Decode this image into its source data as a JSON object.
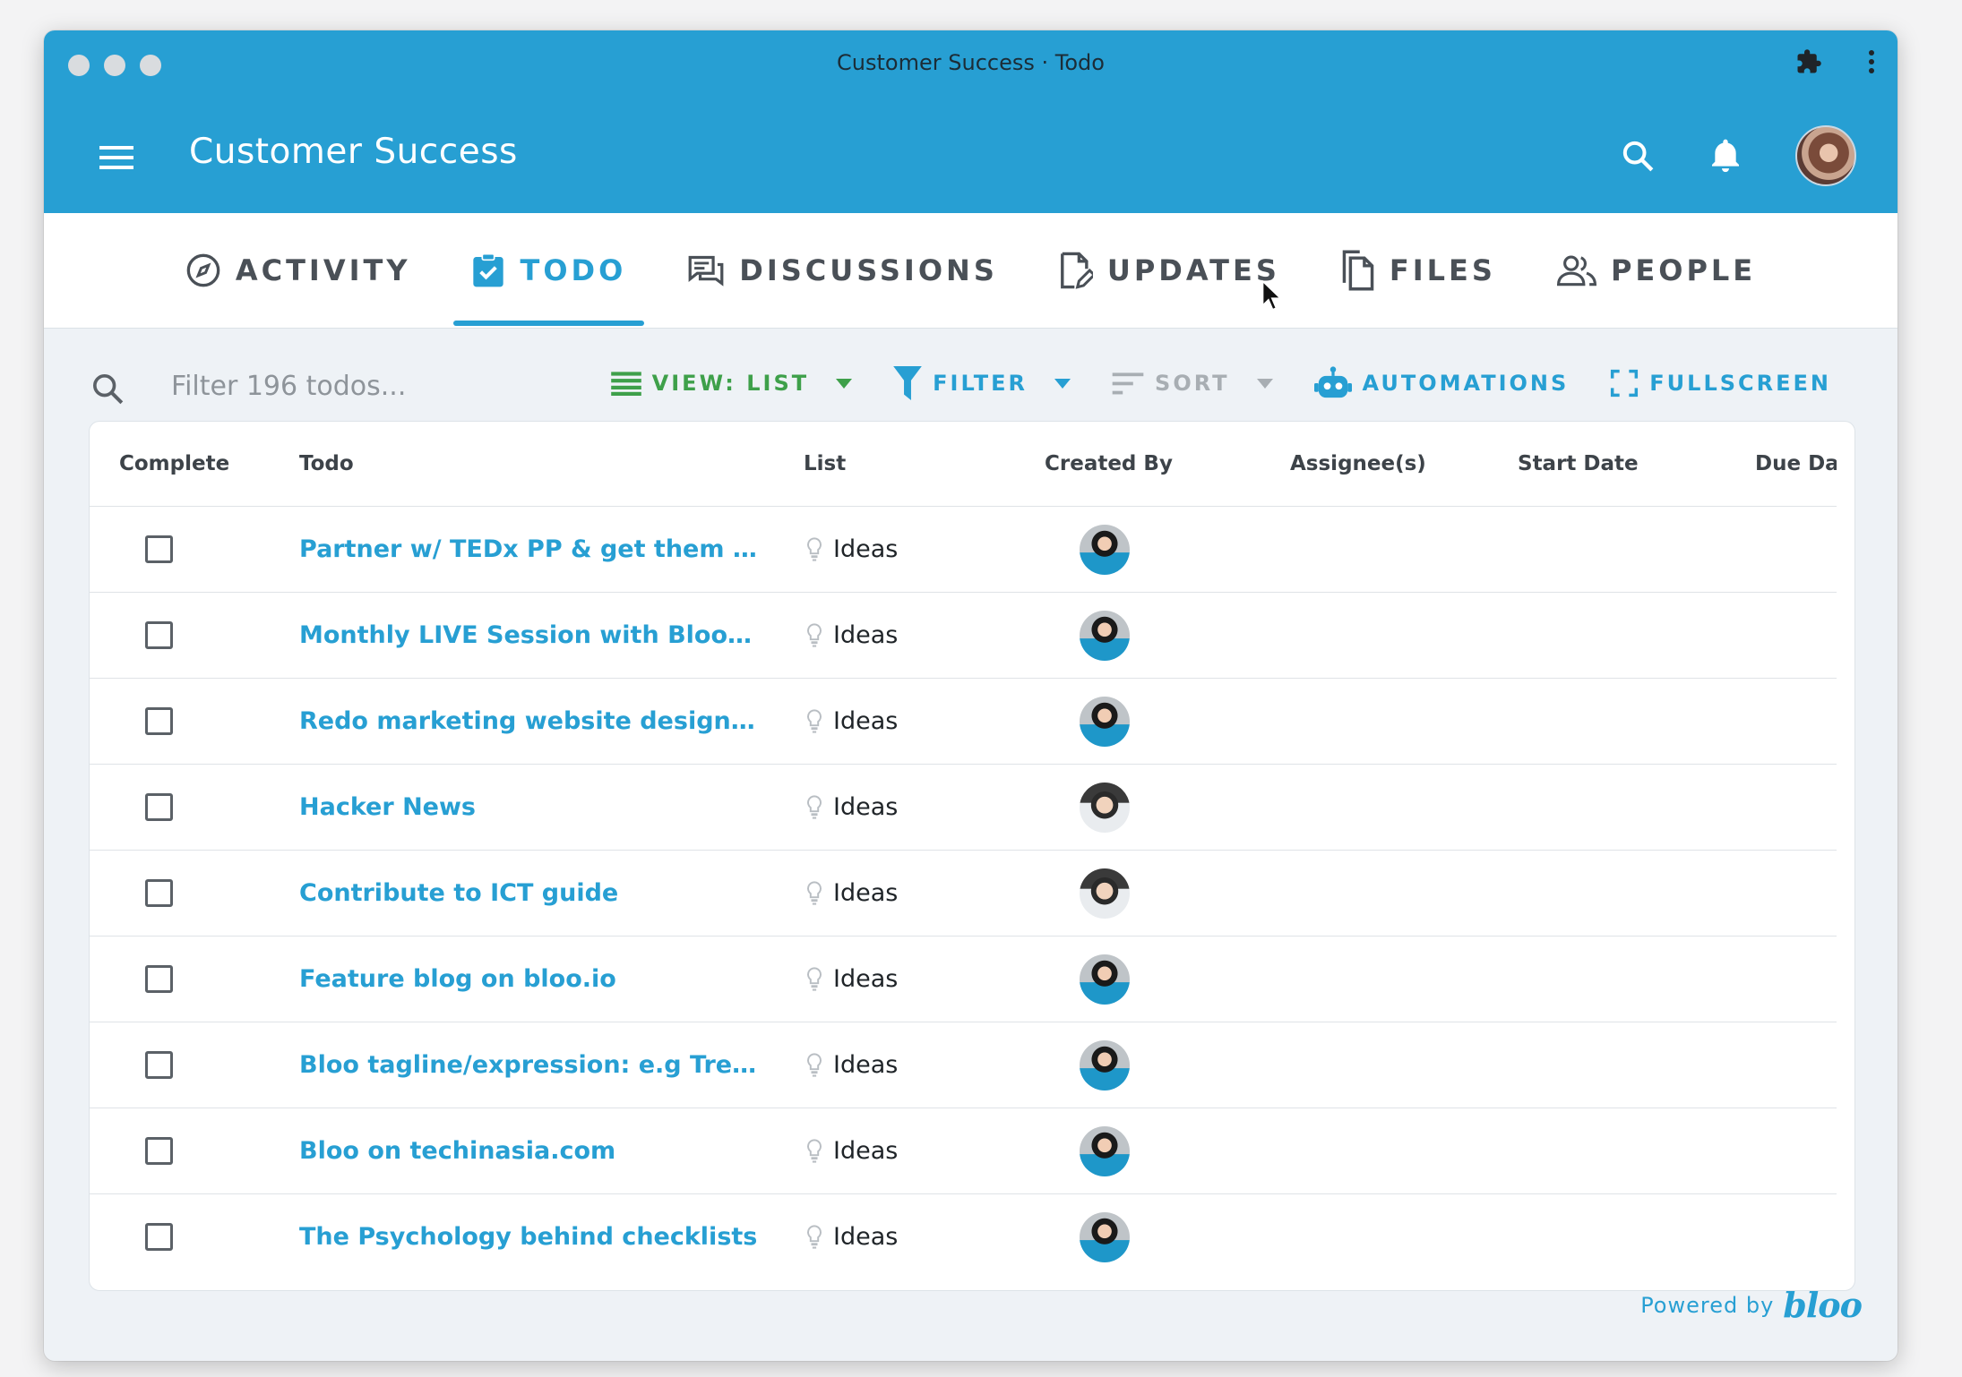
{
  "window": {
    "title": "Customer Success · Todo"
  },
  "header": {
    "app_title": "Customer Success"
  },
  "tabs": [
    {
      "label": "ACTIVITY",
      "icon": "compass-icon",
      "active": false
    },
    {
      "label": "TODO",
      "icon": "checkbox-icon",
      "active": true
    },
    {
      "label": "DISCUSSIONS",
      "icon": "chat-icon",
      "active": false
    },
    {
      "label": "UPDATES",
      "icon": "edit-doc-icon",
      "active": false
    },
    {
      "label": "FILES",
      "icon": "files-icon",
      "active": false
    },
    {
      "label": "PEOPLE",
      "icon": "people-icon",
      "active": false
    }
  ],
  "toolbar": {
    "search_placeholder": "Filter 196 todos...",
    "view_label": "VIEW: LIST",
    "filter_label": "FILTER",
    "sort_label": "SORT",
    "automations_label": "AUTOMATIONS",
    "fullscreen_label": "FULLSCREEN"
  },
  "table": {
    "columns": [
      "Complete",
      "Todo",
      "List",
      "Created By",
      "Assignee(s)",
      "Start Date",
      "Due Date"
    ],
    "rows": [
      {
        "todo": "Partner w/ TEDx PP & get them on B...",
        "list": "Ideas",
        "creator": "woman-avatar"
      },
      {
        "todo": "Monthly LIVE Session with Bloo Tea...",
        "list": "Ideas",
        "creator": "woman-avatar"
      },
      {
        "todo": "Redo marketing website design for ...",
        "list": "Ideas",
        "creator": "woman-avatar"
      },
      {
        "todo": "Hacker News",
        "list": "Ideas",
        "creator": "man-avatar"
      },
      {
        "todo": "Contribute to ICT guide",
        "list": "Ideas",
        "creator": "man-avatar"
      },
      {
        "todo": "Feature blog on bloo.io",
        "list": "Ideas",
        "creator": "woman-avatar"
      },
      {
        "todo": "Bloo tagline/expression: e.g Trello y...",
        "list": "Ideas",
        "creator": "woman-avatar"
      },
      {
        "todo": "Bloo on techinasia.com",
        "list": "Ideas",
        "creator": "woman-avatar"
      },
      {
        "todo": "The Psychology behind checklists",
        "list": "Ideas",
        "creator": "woman-avatar"
      }
    ]
  },
  "footer": {
    "powered_by": "Powered by",
    "brand": "bloo"
  },
  "colors": {
    "brand": "#279fd3",
    "view_green": "#3ea04a",
    "sort_grey": "#a8aeb3"
  }
}
